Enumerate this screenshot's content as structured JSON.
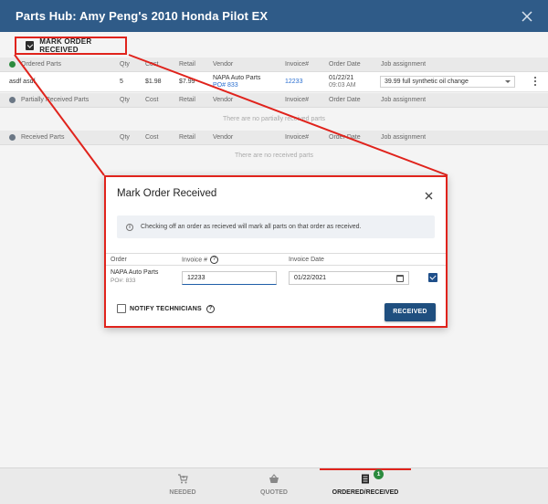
{
  "window": {
    "title": "Parts Hub: Amy Peng's 2010 Honda Pilot EX"
  },
  "toolbar": {
    "mark_label": "MARK ORDER RECEIVED"
  },
  "ordered": {
    "title": "Ordered Parts",
    "status_color": "#2b8a3e",
    "columns": {
      "qty": "Qty",
      "cost": "Cost",
      "retail": "Retail",
      "vendor": "Vendor",
      "invoice": "Invoice#",
      "order_date": "Order Date",
      "job": "Job assignment"
    },
    "row": {
      "name": "asdf asdf",
      "qty": "5",
      "cost": "$1.98",
      "retail": "$7.99",
      "vendor": "NAPA Auto Parts",
      "po": "PO# 833",
      "invoice": "12233",
      "date": "01/22/21",
      "time": "09:03 AM",
      "job": "39.99 full synthetic oil change"
    }
  },
  "partial": {
    "title": "Partially Received Parts",
    "status_color": "#6b7785",
    "columns": {
      "qty": "Qty",
      "cost": "Cost",
      "retail": "Retail",
      "vendor": "Vendor",
      "invoice": "Invoice#",
      "order_date": "Order Date",
      "job": "Job assignment"
    },
    "empty": "There are no partially received parts"
  },
  "received": {
    "title": "Received Parts",
    "status_color": "#6b7785",
    "columns": {
      "qty": "Qty",
      "cost": "Cost",
      "retail": "Retail",
      "vendor": "Vendor",
      "invoice": "Invoice#",
      "order_date": "Order Date",
      "job": "Job assignment"
    },
    "empty": "There are no received parts"
  },
  "modal": {
    "title": "Mark Order Received",
    "info": "Checking off an order as recieved will mark all parts on that order as received.",
    "col_order": "Order",
    "col_invoice": "Invoice #",
    "col_date": "Invoice Date",
    "vendor": "NAPA Auto Parts",
    "po": "PO#: 833",
    "invoice_value": "12233",
    "date_value": "01/22/2021",
    "notify_label": "NOTIFY TECHNICIANS",
    "received_label": "RECEIVED",
    "help_glyph": "?",
    "info_glyph": "i"
  },
  "nav": {
    "needed": "NEEDED",
    "quoted": "QUOTED",
    "ordered": "ORDERED/RECEIVED",
    "badge": "1"
  },
  "colors": {
    "header": "#2f5b88",
    "highlight": "#e0231c",
    "primary_button": "#1f4f7f"
  }
}
